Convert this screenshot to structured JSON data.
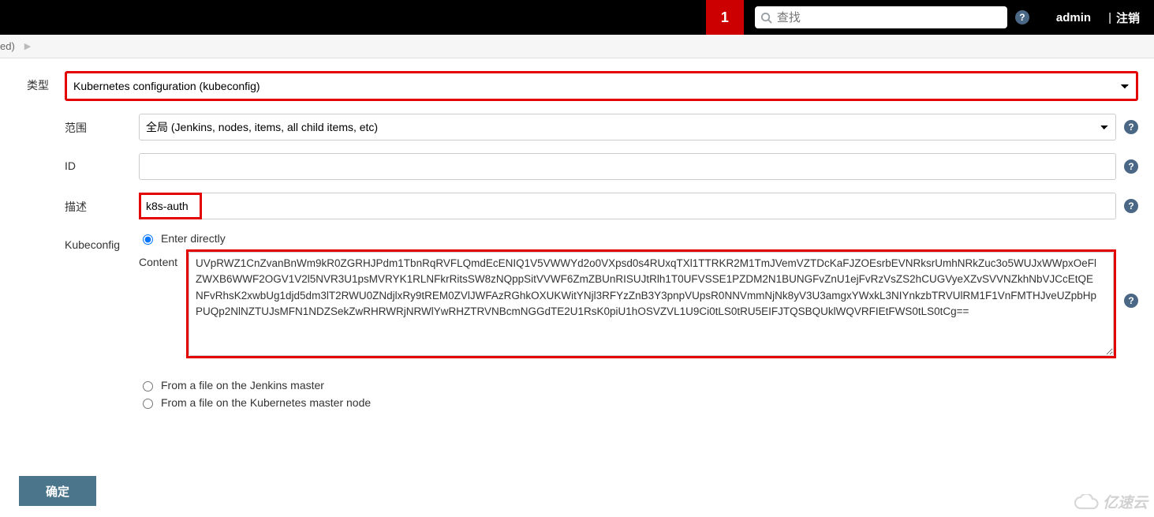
{
  "header": {
    "badge": "1",
    "search_placeholder": "查找",
    "user": "admin",
    "logout": "注销"
  },
  "breadcrumb": {
    "item": "ed)"
  },
  "form": {
    "type_label": "类型",
    "type_value": "Kubernetes configuration (kubeconfig)",
    "scope_label": "范围",
    "scope_value": "全局 (Jenkins, nodes, items, all child items, etc)",
    "id_label": "ID",
    "id_value": "",
    "desc_label": "描述",
    "desc_value": "k8s-auth",
    "kubeconfig_label": "Kubeconfig",
    "radio_enter_directly": "Enter directly",
    "content_label": "Content",
    "content_value": "UVpRWZ1CnZvanBnWm9kR0ZGRHJPdm1TbnRqRVFLQmdEcENIQ1V5VWWYd2o0VXpsd0s4RUxqTXl1TTRKR2M1TmJVemVZTDcKaFJZOEsrbEVNRksrUmhNRkZuc3o5WUJxWWpxOeFlZWXB6WWF2OGV1V2l5NVR3U1psMVRYK1RLNFkrRitsSW8zNQppSitVVWF6ZmZBUnRISUJtRlh1T0UFVSSE1PZDM2N1BUNGFvZnU1ejFvRzVsZS2hCUGVyeXZvSVVNZkhNbVJCcEtQENFvRhsK2xwbUg1djd5dm3lT2RWU0ZNdjlxRy9tREM0ZVlJWFAzRGhkOXUKWitYNjl3RFYzZnB3Y3pnpVUpsR0NNVmmNjNk8yV3U3amgxYWxkL3NIYnkzbTRVUlRM1F1VnFMTHJveUZpbHpPUQp2NlNZTUJsMFN1NDZSekZwRHRWRjNRWlYwRHZTRVNBcmNGGdTE2U1RsK0piU1hOSVZVL1U9Ci0tLS0tRU5EIFJTQSBQUklWQVRFIEtFWS0tLS0tCg==",
    "radio_file_jenkins": "From a file on the Jenkins master",
    "radio_file_k8s": "From a file on the Kubernetes master node"
  },
  "buttons": {
    "submit": "确定"
  },
  "watermark": "亿速云"
}
